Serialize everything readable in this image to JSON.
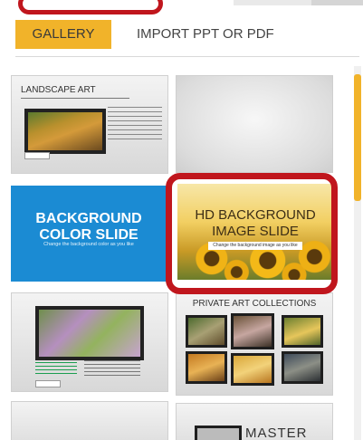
{
  "tabs": {
    "gallery": "GALLERY",
    "import": "IMPORT PPT OR PDF"
  },
  "thumbnails": {
    "landscape": {
      "title": "LANDSCAPE ART"
    },
    "background": {
      "title_line1": "BACKGROUND",
      "title_line2": "COLOR SLIDE",
      "subtitle": "Change the background color as you like"
    },
    "hd": {
      "title_line1": "HD BACKGROUND",
      "title_line2": "IMAGE SLIDE",
      "subtitle": "Change the background image as you like"
    },
    "private": {
      "title": "PRIVATE ART COLLECTIONS"
    },
    "master": {
      "title": "MASTER"
    }
  },
  "colors": {
    "accent": "#f1b32a",
    "highlight": "#c0161d",
    "blue_slide": "#1b8bd3"
  }
}
